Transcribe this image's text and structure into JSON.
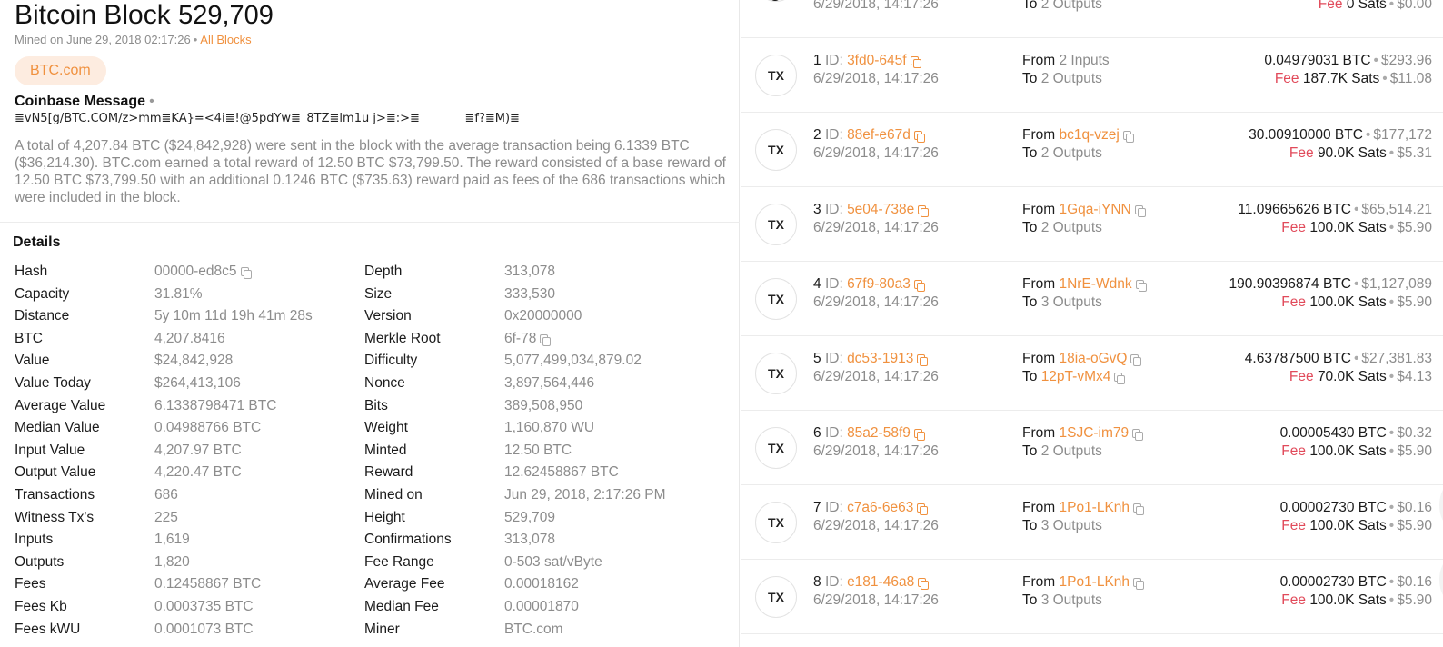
{
  "header": {
    "title_text": "Bitcoin Block",
    "height": "529,709",
    "mined_label": "Mined on June 29, 2018 02:17:26",
    "all_blocks_link": "All Blocks",
    "pool_pill": "BTC.com"
  },
  "coinbase": {
    "title": "Coinbase Message",
    "message": "≣vN5[g/BTC.COM/z>mm≣KA}=<4i≣!@5pdYw≣_8TZ≣lm1u j>≣:>≣            ≣f?≣M)≣"
  },
  "summary": "A total of 4,207.84 BTC ($24,842,928) were sent in the block with the average transaction being 6.1339 BTC ($36,214.30). BTC.com earned a total reward of 12.50 BTC $73,799.50. The reward consisted of a base reward of 12.50 BTC $73,799.50 with an additional 0.1246 BTC ($735.63) reward paid as fees of the 686 transactions which were included in the block.",
  "details": {
    "title": "Details",
    "left": [
      {
        "k": "Hash",
        "v": "00000-ed8c5",
        "copy": true
      },
      {
        "k": "Capacity",
        "v": "31.81%"
      },
      {
        "k": "Distance",
        "v": "5y 10m 11d 19h 41m 28s"
      },
      {
        "k": "BTC",
        "v": "4,207.8416"
      },
      {
        "k": "Value",
        "v": "$24,842,928"
      },
      {
        "k": "Value Today",
        "v": "$264,413,106"
      },
      {
        "k": "Average Value",
        "v": "6.1338798471 BTC"
      },
      {
        "k": "Median Value",
        "v": "0.04988766 BTC"
      },
      {
        "k": "Input Value",
        "v": "4,207.97 BTC"
      },
      {
        "k": "Output Value",
        "v": "4,220.47 BTC"
      },
      {
        "k": "Transactions",
        "v": "686"
      },
      {
        "k": "Witness Tx's",
        "v": "225"
      },
      {
        "k": "Inputs",
        "v": "1,619"
      },
      {
        "k": "Outputs",
        "v": "1,820"
      },
      {
        "k": "Fees",
        "v": "0.12458867 BTC"
      },
      {
        "k": "Fees Kb",
        "v": "0.0003735 BTC"
      },
      {
        "k": "Fees kWU",
        "v": "0.0001073 BTC"
      }
    ],
    "right": [
      {
        "k": "Depth",
        "v": "313,078"
      },
      {
        "k": "Size",
        "v": "333,530"
      },
      {
        "k": "Version",
        "v": "0x20000000"
      },
      {
        "k": "Merkle Root",
        "v": "6f-78",
        "copy": true
      },
      {
        "k": "Difficulty",
        "v": "5,077,499,034,879.02"
      },
      {
        "k": "Nonce",
        "v": "3,897,564,446"
      },
      {
        "k": "Bits",
        "v": "389,508,950"
      },
      {
        "k": "Weight",
        "v": "1,160,870 WU"
      },
      {
        "k": "Minted",
        "v": "12.50 BTC"
      },
      {
        "k": "Reward",
        "v": "12.62458867 BTC"
      },
      {
        "k": "Mined on",
        "v": "Jun 29, 2018, 2:17:26 PM"
      },
      {
        "k": "Height",
        "v": "529,709"
      },
      {
        "k": "Confirmations",
        "v": "313,078"
      },
      {
        "k": "Fee Range",
        "v": "0-503 sat/vByte"
      },
      {
        "k": "Average Fee",
        "v": "0.00018162"
      },
      {
        "k": "Median Fee",
        "v": "0.00001870"
      },
      {
        "k": "Miner",
        "v": "BTC.com"
      }
    ]
  },
  "tx_partial": {
    "date": "6/29/2018, 14:17:26",
    "to": "To",
    "to_value": "2 Outputs",
    "fee_label": "Fee",
    "fee": "0 Sats",
    "fee_usd": "$0.00"
  },
  "transactions": [
    {
      "icon": "TX",
      "index": "1",
      "id_label": "ID:",
      "id": "3fd0-645f",
      "date": "6/29/2018, 14:17:26",
      "from_label": "From",
      "from": "2 Inputs",
      "from_link": false,
      "to_label": "To",
      "to": "2 Outputs",
      "to_link": false,
      "amount": "0.04979031 BTC",
      "amount_usd": "$293.96",
      "fee_label": "Fee",
      "fee": "187.7K Sats",
      "fee_usd": "$11.08"
    },
    {
      "icon": "TX",
      "index": "2",
      "id_label": "ID:",
      "id": "88ef-e67d",
      "date": "6/29/2018, 14:17:26",
      "from_label": "From",
      "from": "bc1q-vzej",
      "from_link": true,
      "to_label": "To",
      "to": "2 Outputs",
      "to_link": false,
      "amount": "30.00910000 BTC",
      "amount_usd": "$177,172",
      "fee_label": "Fee",
      "fee": "90.0K Sats",
      "fee_usd": "$5.31"
    },
    {
      "icon": "TX",
      "index": "3",
      "id_label": "ID:",
      "id": "5e04-738e",
      "date": "6/29/2018, 14:17:26",
      "from_label": "From",
      "from": "1Gqa-iYNN",
      "from_link": true,
      "to_label": "To",
      "to": "2 Outputs",
      "to_link": false,
      "amount": "11.09665626 BTC",
      "amount_usd": "$65,514.21",
      "fee_label": "Fee",
      "fee": "100.0K Sats",
      "fee_usd": "$5.90"
    },
    {
      "icon": "TX",
      "index": "4",
      "id_label": "ID:",
      "id": "67f9-80a3",
      "date": "6/29/2018, 14:17:26",
      "from_label": "From",
      "from": "1NrE-Wdnk",
      "from_link": true,
      "to_label": "To",
      "to": "3 Outputs",
      "to_link": false,
      "amount": "190.90396874 BTC",
      "amount_usd": "$1,127,089",
      "fee_label": "Fee",
      "fee": "100.0K Sats",
      "fee_usd": "$5.90"
    },
    {
      "icon": "TX",
      "index": "5",
      "id_label": "ID:",
      "id": "dc53-1913",
      "date": "6/29/2018, 14:17:26",
      "from_label": "From",
      "from": "18ia-oGvQ",
      "from_link": true,
      "to_label": "To",
      "to": "12pT-vMx4",
      "to_link": true,
      "amount": "4.63787500 BTC",
      "amount_usd": "$27,381.83",
      "fee_label": "Fee",
      "fee": "70.0K Sats",
      "fee_usd": "$4.13"
    },
    {
      "icon": "TX",
      "index": "6",
      "id_label": "ID:",
      "id": "85a2-58f9",
      "date": "6/29/2018, 14:17:26",
      "from_label": "From",
      "from": "1SJC-im79",
      "from_link": true,
      "to_label": "To",
      "to": "2 Outputs",
      "to_link": false,
      "amount": "0.00005430 BTC",
      "amount_usd": "$0.32",
      "fee_label": "Fee",
      "fee": "100.0K Sats",
      "fee_usd": "$5.90"
    },
    {
      "icon": "TX",
      "index": "7",
      "id_label": "ID:",
      "id": "c7a6-6e63",
      "date": "6/29/2018, 14:17:26",
      "from_label": "From",
      "from": "1Po1-LKnh",
      "from_link": true,
      "to_label": "To",
      "to": "3 Outputs",
      "to_link": false,
      "amount": "0.00002730 BTC",
      "amount_usd": "$0.16",
      "fee_label": "Fee",
      "fee": "100.0K Sats",
      "fee_usd": "$5.90"
    },
    {
      "icon": "TX",
      "index": "8",
      "id_label": "ID:",
      "id": "e181-46a8",
      "date": "6/29/2018, 14:17:26",
      "from_label": "From",
      "from": "1Po1-LKnh",
      "from_link": true,
      "to_label": "To",
      "to": "3 Outputs",
      "to_link": false,
      "amount": "0.00002730 BTC",
      "amount_usd": "$0.16",
      "fee_label": "Fee",
      "fee": "100.0K Sats",
      "fee_usd": "$5.90"
    }
  ],
  "colors": {
    "accent": "#f0913f",
    "fee_red": "#e14a5a",
    "muted": "#8c8c8c",
    "pill_bg": "#fdece0"
  },
  "icons": {
    "copy": "copy-icon",
    "tx": "tx-icon"
  }
}
